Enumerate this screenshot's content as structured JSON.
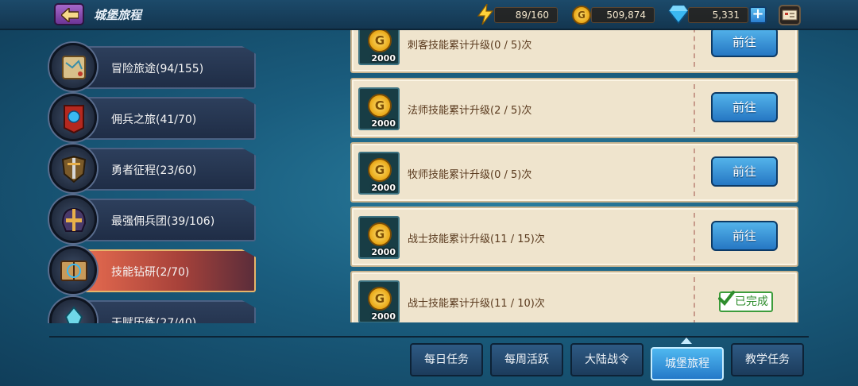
{
  "header": {
    "title": "城堡旅程",
    "stamina": "89/160",
    "gold": "509,874",
    "gems": "5,331",
    "plus": "+"
  },
  "categories": [
    {
      "label": "冒险旅途(94/155)",
      "icon": "map-scroll-icon"
    },
    {
      "label": "佣兵之旅(41/70)",
      "icon": "banner-icon"
    },
    {
      "label": "勇者征程(23/60)",
      "icon": "sword-crest-icon"
    },
    {
      "label": "最强佣兵团(39/106)",
      "icon": "helmet-icon"
    },
    {
      "label": "技能钻研(2/70)",
      "icon": "spellbook-icon",
      "active": true
    },
    {
      "label": "天赋历练(27/40)",
      "icon": "crystal-icon"
    }
  ],
  "quests": [
    {
      "text": "刺客技能累计升级(0 / 5)次",
      "reward": "2000",
      "coin": "G",
      "action": "前往"
    },
    {
      "text": "法师技能累计升级(2 / 5)次",
      "reward": "2000",
      "coin": "G",
      "action": "前往"
    },
    {
      "text": "牧师技能累计升级(0 / 5)次",
      "reward": "2000",
      "coin": "G",
      "action": "前往"
    },
    {
      "text": "战士技能累计升级(11 / 15)次",
      "reward": "2000",
      "coin": "G",
      "action": "前往"
    },
    {
      "text": "战士技能累计升级(11 / 10)次",
      "reward": "2000",
      "coin": "G",
      "action": "已完成"
    }
  ],
  "tabs": [
    {
      "label": "每日任务"
    },
    {
      "label": "每周活跃"
    },
    {
      "label": "大陆战令"
    },
    {
      "label": "城堡旅程",
      "active": true
    },
    {
      "label": "教学任务"
    }
  ],
  "colors": {
    "accent": "#2677c3",
    "active_category": "#e46a4f",
    "card_bg": "#efe4cd",
    "done_green": "#2f8d2d"
  }
}
